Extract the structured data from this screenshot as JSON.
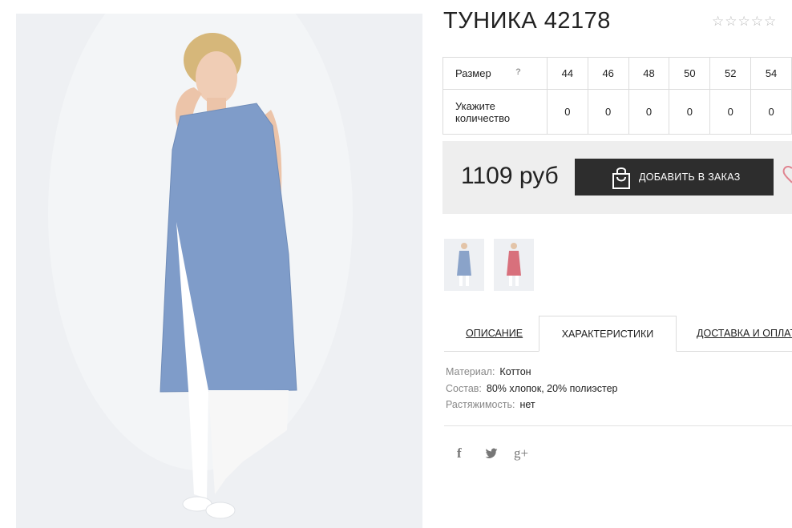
{
  "product": {
    "title": "ТУНИКА 42178",
    "rating_stars": 5,
    "rating_value": 0
  },
  "sizes": {
    "size_label": "Размер",
    "hint": "?",
    "qty_label": "Укажите количество",
    "values": [
      "44",
      "46",
      "48",
      "50",
      "52",
      "54"
    ],
    "quantities": [
      "0",
      "0",
      "0",
      "0",
      "0",
      "0"
    ]
  },
  "purchase": {
    "price": "1109 руб",
    "add_button": "ДОБАВИТЬ В ЗАКАЗ"
  },
  "thumbnails": [
    {
      "color": "blue",
      "dress_color": "#8aa3c9"
    },
    {
      "color": "pink",
      "dress_color": "#d8707c"
    }
  ],
  "tabs": [
    {
      "label": "ОПИСАНИЕ",
      "active": false
    },
    {
      "label": "ХАРАКТЕРИСТИКИ",
      "active": true
    },
    {
      "label": "ДОСТАВКА И ОПЛАТА",
      "active": false
    }
  ],
  "specs": [
    {
      "key": "Материал:",
      "value": "Коттон"
    },
    {
      "key": "Состав:",
      "value": "80% хлопок, 20% полиэстер"
    },
    {
      "key": "Растяжимость:",
      "value": "нет"
    }
  ],
  "social": {
    "facebook": "f",
    "twitter": "twitter-icon",
    "google_plus": "g+"
  },
  "colors": {
    "button_bg": "#2d2d2d",
    "price_bg": "#eeeeee",
    "heart": "#e0838f",
    "dress_blue": "#7f9cc9"
  }
}
